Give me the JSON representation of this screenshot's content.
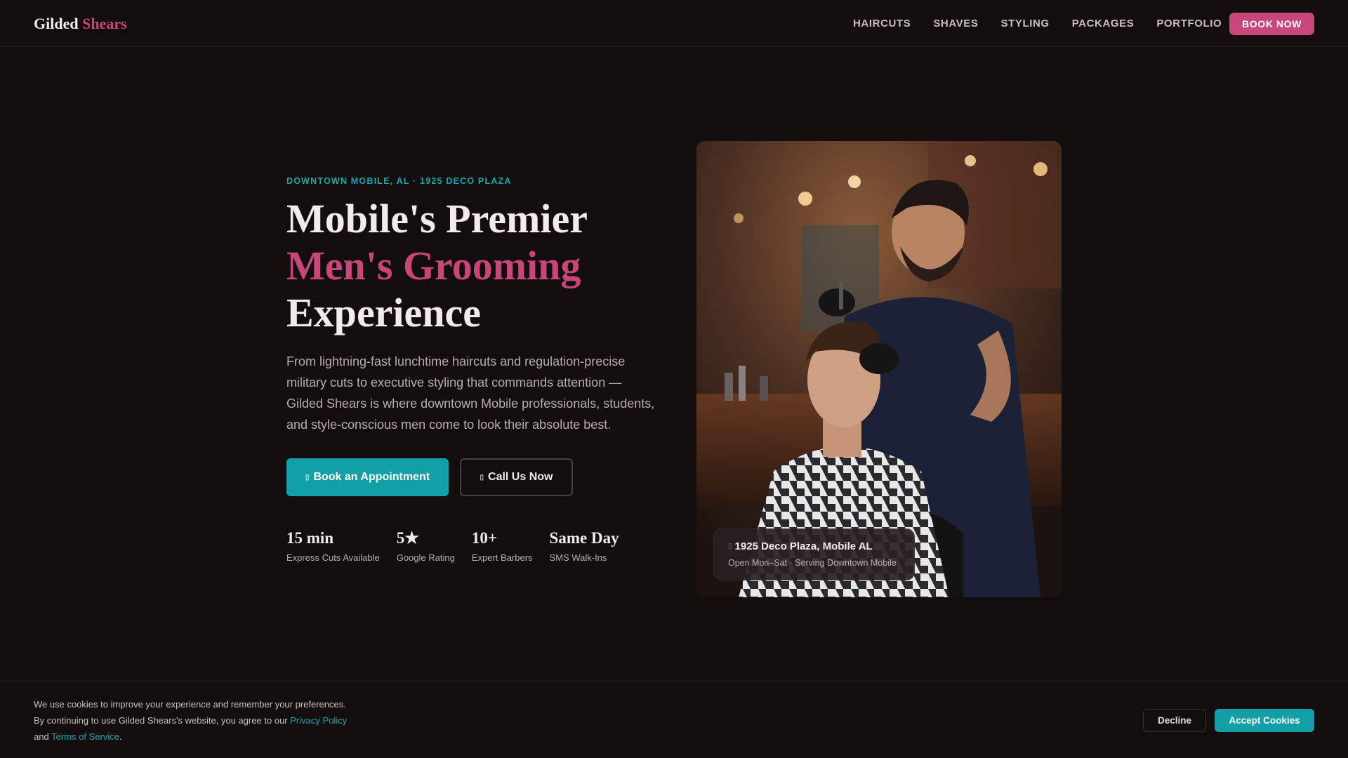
{
  "brand": {
    "name_part1": "Gilded",
    "name_part2": "Shears",
    "accent_color": "#c8467a",
    "teal_color": "#129fa8"
  },
  "nav": {
    "items": [
      "HAIRCUTS",
      "SHAVES",
      "STYLING",
      "PACKAGES",
      "PORTFOLIO"
    ],
    "cta": "BOOK NOW"
  },
  "hero": {
    "eyebrow": "DOWNTOWN MOBILE, AL · 1925 DECO PLAZA",
    "headline_line1": "Mobile's Premier",
    "headline_line2": "Men's Grooming",
    "headline_line3": "Experience",
    "lead": "From lightning-fast lunchtime haircuts and regulation-precise military cuts to executive styling that commands attention — Gilded Shears is where downtown Mobile professionals, students, and style-conscious men come to look their absolute best.",
    "primary_button": "Book an Appointment",
    "primary_button_icon": "calendar-icon",
    "secondary_button": "Call Us Now",
    "secondary_button_icon": "phone-icon"
  },
  "stats": [
    {
      "value": "15 min",
      "label": "Express Cuts Available"
    },
    {
      "value": "5★",
      "label": "Google Rating"
    },
    {
      "value": "10+",
      "label": "Expert Barbers"
    },
    {
      "value": "Same Day",
      "label": "SMS Walk-Ins"
    }
  ],
  "location_card": {
    "title": "1925 Deco Plaza, Mobile AL",
    "subtitle": "Open Mon–Sat · Serving Downtown Mobile",
    "icon": "map-pin-icon"
  },
  "cookie": {
    "text_before": "We use cookies to improve your experience and remember your preferences. By continuing to use Gilded Shears's website, you agree to our",
    "privacy_link": "Privacy Policy",
    "and": "and",
    "terms_link": "Terms of Service",
    "period": ".",
    "decline": "Decline",
    "accept": "Accept Cookies"
  }
}
